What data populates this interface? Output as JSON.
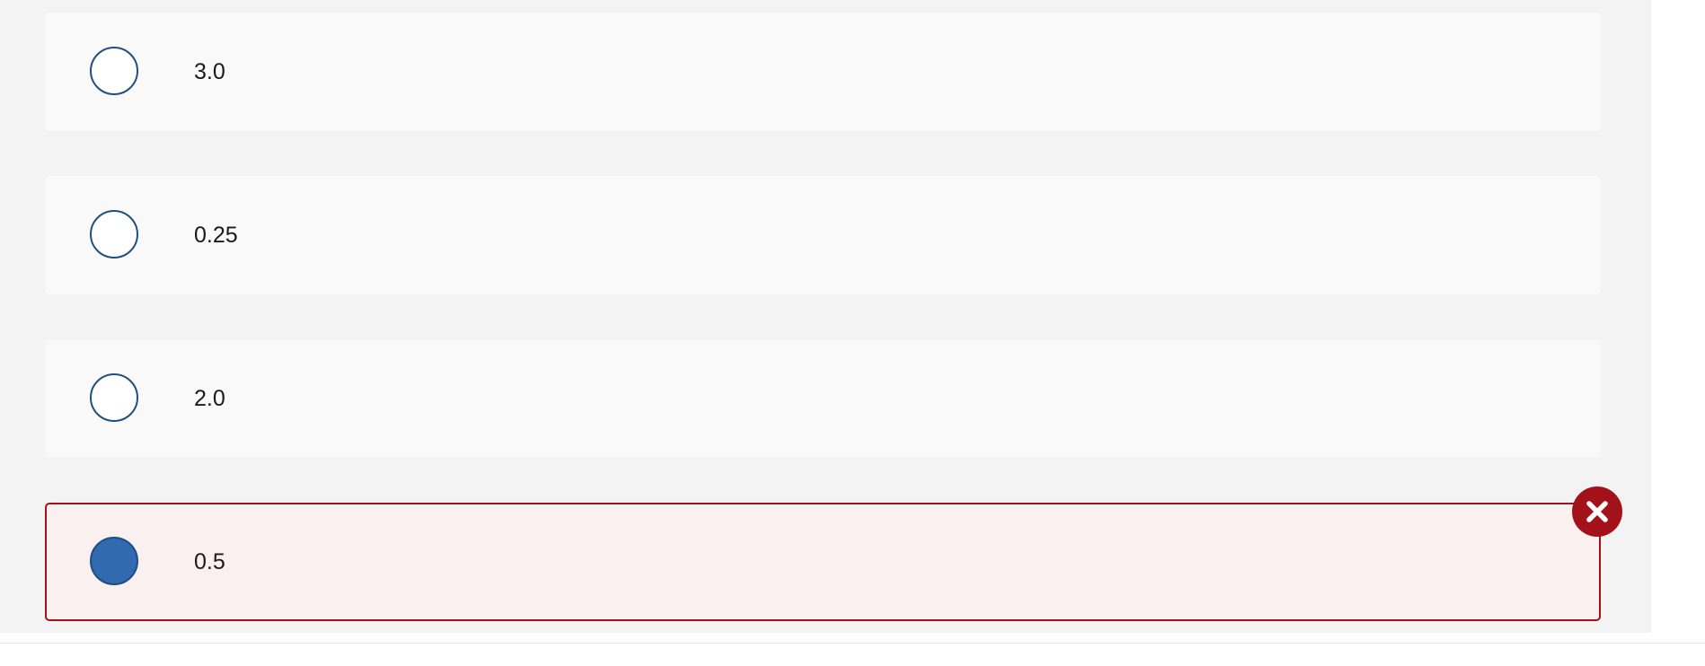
{
  "question": {
    "options": [
      {
        "label": "3.0",
        "selected": false,
        "state": "default"
      },
      {
        "label": "0.25",
        "selected": false,
        "state": "default"
      },
      {
        "label": "2.0",
        "selected": false,
        "state": "default"
      },
      {
        "label": "0.5",
        "selected": true,
        "state": "incorrect"
      }
    ],
    "feedback_icon": "close-icon"
  },
  "colors": {
    "panel_background": "#f3f3f3",
    "option_background": "#f9f9f9",
    "radio_border": "#1e4f82",
    "radio_checked_fill": "#326aaf",
    "incorrect_border": "#a3121a",
    "incorrect_background": "#fbf0f0"
  }
}
